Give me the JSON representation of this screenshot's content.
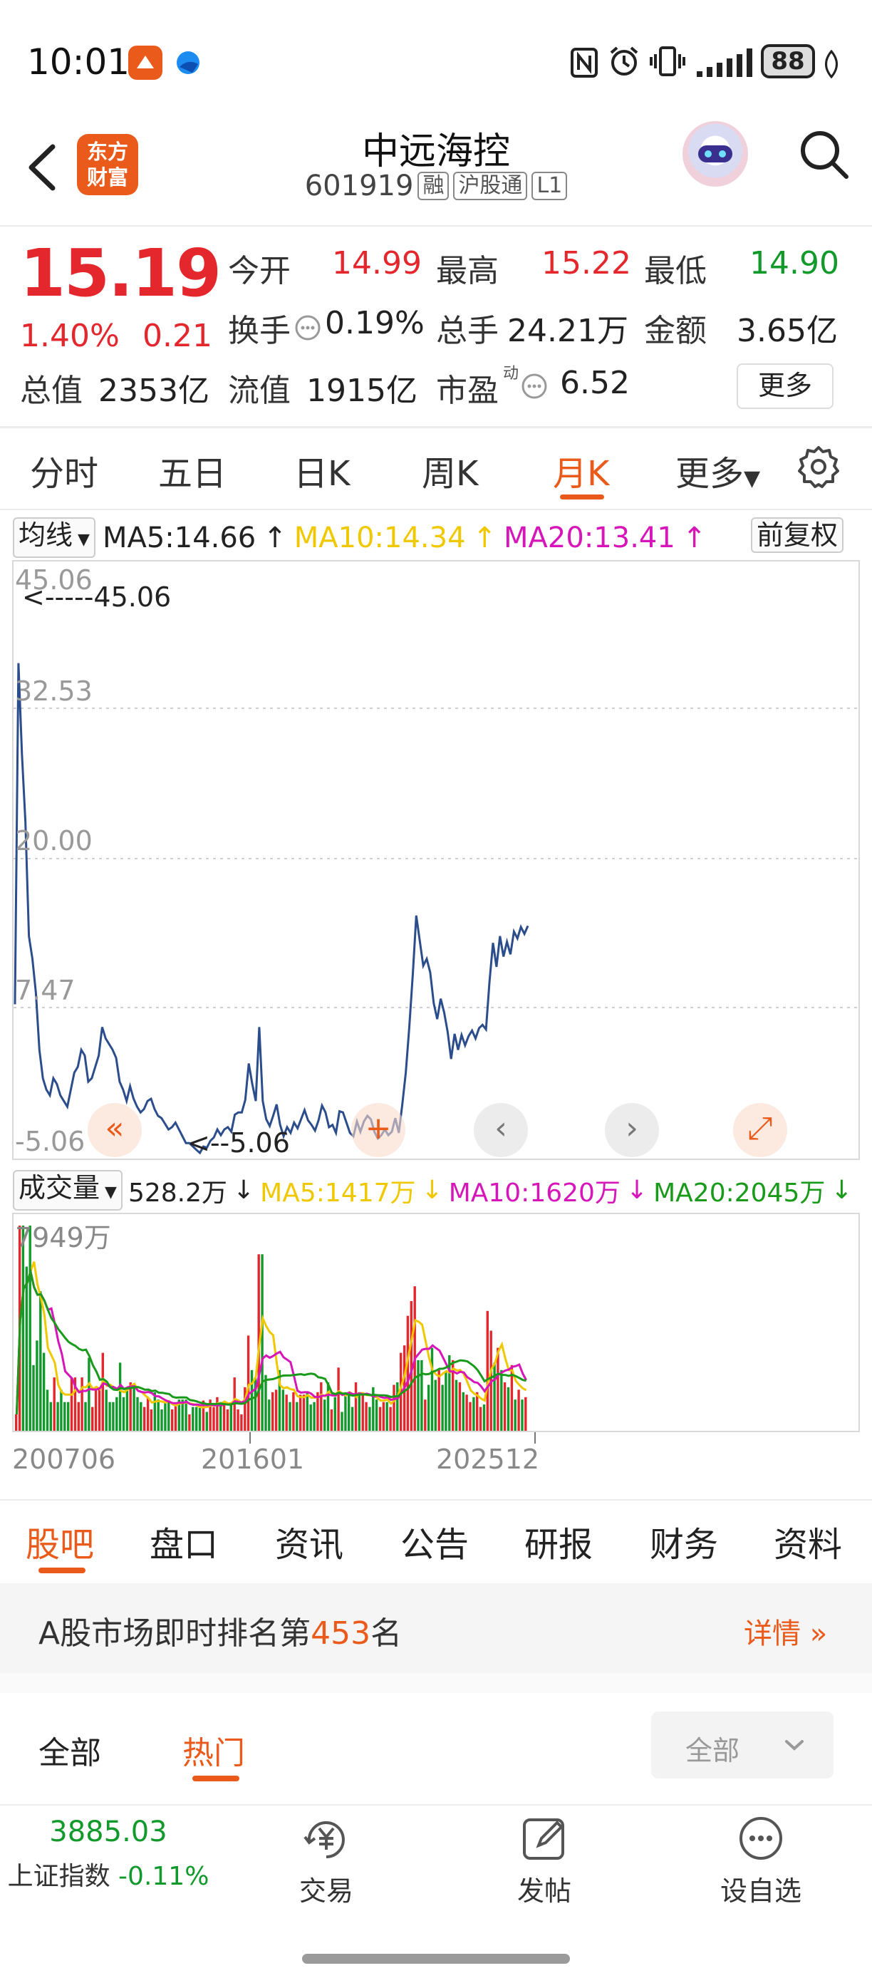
{
  "status_bar": {
    "time": "10:01",
    "battery": "88"
  },
  "header": {
    "back": "back",
    "brand": [
      "东方",
      "财富"
    ],
    "stock_name": "中远海控",
    "stock_code": "601919",
    "tags": [
      "融",
      "沪股通",
      "L1"
    ]
  },
  "quote": {
    "price": "15.19",
    "change_pct": "1.40%",
    "change_amt": "0.21",
    "open_label": "今开",
    "open": "14.99",
    "high_label": "最高",
    "high": "15.22",
    "low_label": "最低",
    "low": "14.90",
    "turnover_label": "换手",
    "turnover": "0.19%",
    "volume_label": "总手",
    "volume": "24.21万",
    "amount_label": "金额",
    "amount": "3.65亿",
    "mcap_label": "总值",
    "mcap": "2353亿",
    "float_label": "流值",
    "float": "1915亿",
    "pe_label": "市盈",
    "pe_sup": "动",
    "pe": "6.52",
    "more": "更多"
  },
  "period_tabs": [
    "分时",
    "五日",
    "日K",
    "周K",
    "月K",
    "更多"
  ],
  "active_period": "月K",
  "kline": {
    "indicator_select": "均线",
    "ma5": "MA5:14.66",
    "ma10": "MA10:14.34",
    "ma20": "MA20:13.41",
    "adjust": "前复权",
    "y_labels": [
      "45.06",
      "32.53",
      "20.00",
      "7.47",
      "-5.06"
    ],
    "max_label": "<-----45.06",
    "min_label": "<--5.06"
  },
  "volume_panel": {
    "indicator_select": "成交量",
    "current": "528.2万",
    "ma5": "MA5:1417万",
    "ma10": "MA10:1620万",
    "ma20": "MA20:2045万",
    "y_max": "7949万",
    "x_labels": [
      "200706",
      "201601",
      "202512"
    ]
  },
  "chart_data": {
    "type": "line",
    "title": "",
    "series": [
      {
        "values": [
          8,
          38,
          30,
          24,
          14,
          12,
          9,
          4,
          1.5,
          0.5,
          0,
          1.5,
          1,
          0,
          -0.5,
          -1,
          0.5,
          2,
          2.5,
          4,
          3.5,
          1.2,
          1.5,
          2.5,
          3.5,
          6,
          5,
          4.5,
          4,
          3.3,
          1.2,
          0.5,
          -0.5,
          0.8,
          -0.3,
          -1,
          -1.5,
          -1.2,
          -0.5,
          -0.3,
          -1.2,
          -1.8,
          -2,
          -2.5,
          -3,
          -2.8,
          -2.4,
          -3,
          -3.6,
          -4.2,
          -4.2,
          -4.5,
          -4.8,
          -5.06,
          -4.5,
          -4.6,
          -4.0,
          -3.7,
          -3.0,
          -3.5,
          -3.0,
          -2.8,
          -3.2,
          -1.7,
          -1.5,
          -1.5,
          -0.4,
          2.8,
          1.0,
          -0.5,
          6.0,
          -0.5,
          -2.1,
          -2.7,
          -1.8,
          -0.8,
          -2.6,
          -3.6,
          -2.8,
          -3.3,
          -2.4,
          -2.9,
          -2.1,
          -1.3,
          -2.2,
          -2.6,
          -3.1,
          -2.2,
          -0.9,
          -1.5,
          -2.8,
          -2.6,
          -3.3,
          -1.4,
          -1.5,
          -2.4,
          -3.3,
          -3.6,
          -2.3,
          -3.2,
          -2.3,
          -1.8,
          -2.1,
          -3.2,
          -3.8,
          -3.5,
          -3.0,
          -3.5,
          -3.2,
          -2.0,
          -3.3,
          -0.8,
          2.0,
          6.0,
          10.6,
          15.8,
          13.6,
          11.4,
          12.0,
          10.8,
          8.1,
          6.7,
          8.5,
          7.3,
          5.6,
          3.2,
          5.4,
          4.0,
          5.3,
          4.4,
          5.2,
          5.7,
          5.0,
          5.9,
          6.2,
          5.8,
          10.0,
          13.4,
          11.3,
          14.0,
          12.2,
          13.5,
          12.4,
          14.4,
          13.8,
          14.8,
          14.2,
          14.9
        ]
      }
    ],
    "ylim": [
      -5.06,
      45.06
    ],
    "volume": {
      "unit": "万",
      "ylim": [
        0,
        7949
      ],
      "x_labels": [
        "200706",
        "201601",
        "202512"
      ]
    }
  },
  "chart_controls": [
    "«",
    "+",
    "‹",
    "›",
    "⤢"
  ],
  "content_tabs": [
    "股吧",
    "盘口",
    "资讯",
    "公告",
    "研报",
    "财务",
    "资料"
  ],
  "active_content_tab": "股吧",
  "ranking": {
    "prefix": "A股市场即时排名第",
    "rank": "453",
    "suffix": "名",
    "detail": "详情"
  },
  "sub_tabs": [
    "全部",
    "热门"
  ],
  "active_sub_tab": "热门",
  "filter": {
    "value": "全部"
  },
  "bottom_nav": {
    "index_value": "3885.03",
    "index_name": "上证指数",
    "index_change": "-0.11%",
    "trade": "交易",
    "post": "发帖",
    "add_watch": "设自选"
  },
  "colors": {
    "up": "#e4262d",
    "down": "#119a2b",
    "accent": "#ea5b1b",
    "line": "#2b4d8c",
    "ma5": "#f0c800",
    "ma10": "#d616b8",
    "ma20": "#1a9a1a"
  }
}
